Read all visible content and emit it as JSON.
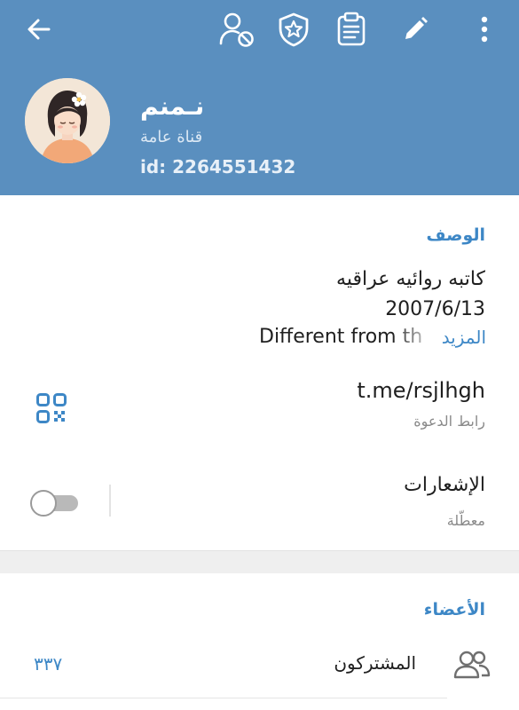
{
  "header": {
    "background_color": "#5a8fbf",
    "icons": {
      "back": "arrow-back-icon",
      "restrict": "user-block-icon",
      "admin": "shield-star-icon",
      "log": "clipboard-icon",
      "edit": "pencil-icon",
      "more": "more-vertical-icon"
    },
    "title": "نـمنم",
    "type_label": "قناة عامة",
    "id_label": "id: 2264551432"
  },
  "description": {
    "section_title": "الوصف",
    "line1": "كاتبه روائيه عراقيه",
    "line2": "2007/6/13",
    "line3": "Different from th",
    "more_label": "المزيد"
  },
  "invite": {
    "link": "t.me/rsjlhgh",
    "sub_label": "رابط الدعوة",
    "icon": "qr-code-icon"
  },
  "notifications": {
    "title": "الإشعارات",
    "status": "معطّلة",
    "enabled": false
  },
  "members": {
    "section_title": "الأعضاء",
    "subscribers_label": "المشتركون",
    "subscribers_count": "٣٣٧",
    "icon": "people-icon"
  },
  "accent_color": "#3d87c6"
}
